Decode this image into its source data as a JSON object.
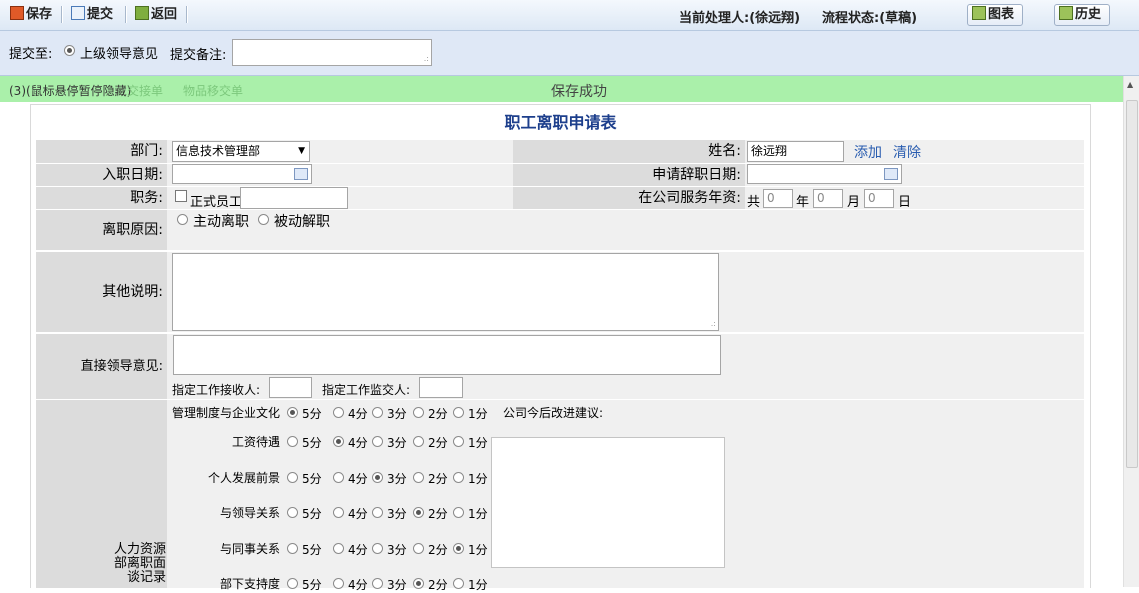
{
  "toolbar": {
    "save": "保存",
    "submit": "提交",
    "back": "返回",
    "handler": "当前处理人:(徐远翔)",
    "status": "流程状态:(草稿)",
    "chart": "图表",
    "history": "历史"
  },
  "submit_bar": {
    "to_label": "提交至:",
    "option": "上级领导意见",
    "remark_label": "提交备注:"
  },
  "message": {
    "hint": "(3)(鼠标悬停暂停隐藏)",
    "ghost1": "交接单",
    "ghost2": "物品移交单",
    "text": "保存成功"
  },
  "form": {
    "title": "职工离职申请表",
    "dept_label": "部门:",
    "dept_value": "信息技术管理部",
    "name_label": "姓名:",
    "name_value": "徐远翔",
    "add": "添加",
    "clear": "清除",
    "entry_label": "入职日期:",
    "resign_label": "申请辞职日期:",
    "post_label": "职务:",
    "formal": "正式员工",
    "service_label": "在公司服务年资:",
    "gong": "共",
    "year_val": "0",
    "year": "年",
    "month_val": "0",
    "month": "月",
    "day_val": "0",
    "day": "日",
    "reason_label": "离职原因:",
    "reason_active": "主动离职",
    "reason_passive": "被动解职",
    "other_label": "其他说明:",
    "leader_label": "直接领导意见:",
    "receiver_label": "指定工作接收人:",
    "supervisor_label": "指定工作监交人:",
    "hr_label": "人力资源部离职面谈记录",
    "suggest_label": "公司今后改进建议:",
    "scores": [
      "5分",
      "4分",
      "3分",
      "2分",
      "1分"
    ],
    "ratings": [
      {
        "item": "管理制度与企业文化",
        "selected": 0
      },
      {
        "item": "工资待遇",
        "selected": 1
      },
      {
        "item": "个人发展前景",
        "selected": 2
      },
      {
        "item": "与领导关系",
        "selected": 3
      },
      {
        "item": "与同事关系",
        "selected": 4
      },
      {
        "item": "部下支持度",
        "selected": 3
      }
    ]
  },
  "colors": {
    "success_bg": "#aaf0aa",
    "title": "#1d3f8c",
    "link": "#2a5db0"
  }
}
